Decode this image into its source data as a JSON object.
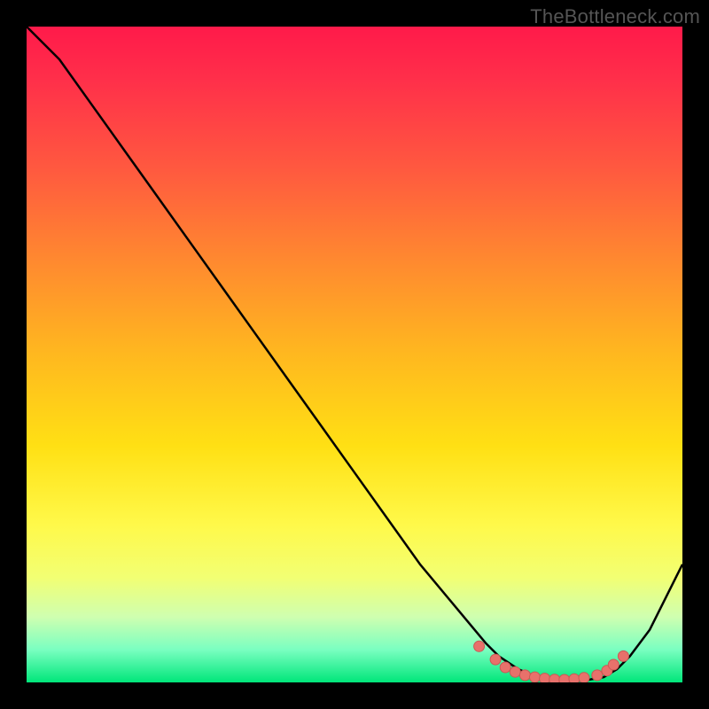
{
  "watermark": "TheBottleneck.com",
  "colors": {
    "curve": "#000000",
    "marker_fill": "#e8716b",
    "marker_stroke": "#c95a55"
  },
  "chart_data": {
    "type": "line",
    "title": "",
    "xlabel": "",
    "ylabel": "",
    "xlim": [
      0,
      100
    ],
    "ylim": [
      0,
      100
    ],
    "series": [
      {
        "name": "curve",
        "x": [
          0,
          5,
          10,
          15,
          20,
          25,
          30,
          35,
          40,
          45,
          50,
          55,
          60,
          65,
          70,
          72,
          75,
          78,
          80,
          82,
          85,
          88,
          90,
          92,
          95,
          100
        ],
        "values": [
          100,
          95,
          88,
          81,
          74,
          67,
          60,
          53,
          46,
          39,
          32,
          25,
          18,
          12,
          6,
          4,
          2,
          0.7,
          0.3,
          0.2,
          0.3,
          0.8,
          2,
          4,
          8,
          18
        ]
      }
    ],
    "markers": {
      "x": [
        69,
        71.5,
        73,
        74.5,
        76,
        77.5,
        79,
        80.5,
        82,
        83.5,
        85,
        87,
        88.5,
        89.5,
        91
      ],
      "y": [
        5.5,
        3.5,
        2.3,
        1.6,
        1.1,
        0.8,
        0.6,
        0.45,
        0.4,
        0.5,
        0.7,
        1.1,
        1.8,
        2.7,
        4.0
      ]
    }
  }
}
